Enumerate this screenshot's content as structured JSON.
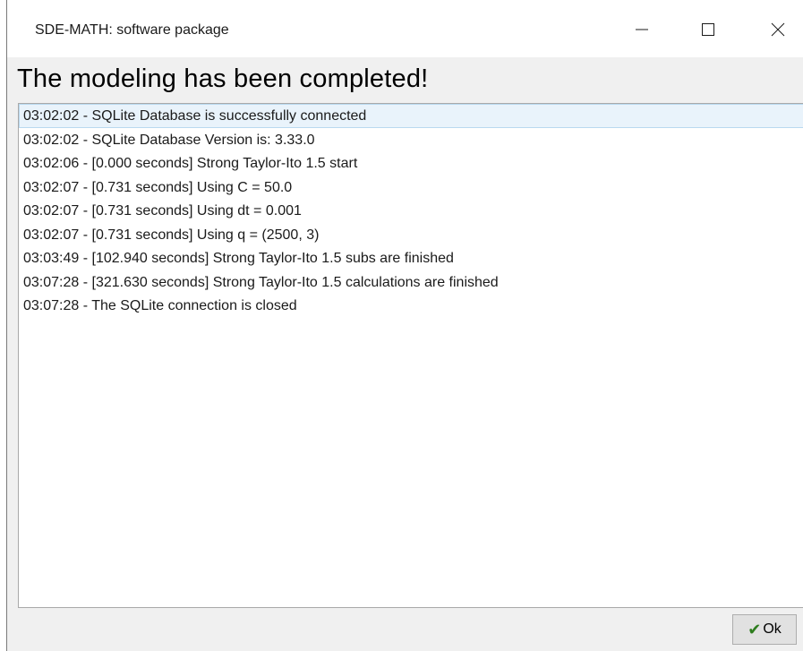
{
  "window": {
    "title": "SDE-MATH: software package",
    "controls": {
      "minimize_icon": "minimize-icon",
      "maximize_icon": "maximize-icon",
      "close_icon": "close-icon"
    }
  },
  "main": {
    "heading": "The modeling has been completed!",
    "log": [
      "03:02:02 - SQLite Database is successfully connected",
      "03:02:02 - SQLite Database Version is: 3.33.0",
      "03:02:06 - [0.000 seconds] Strong Taylor-Ito 1.5 start",
      "03:02:07 - [0.731 seconds] Using C = 50.0",
      "03:02:07 - [0.731 seconds] Using dt = 0.001",
      "03:02:07 - [0.731 seconds] Using q = (2500, 3)",
      "03:03:49 - [102.940 seconds] Strong Taylor-Ito 1.5 subs are finished",
      "03:07:28 - [321.630 seconds] Strong Taylor-Ito 1.5 calculations are finished",
      "03:07:28 - The SQLite connection is closed"
    ],
    "selected_index": 0
  },
  "footer": {
    "ok_label": "Ok",
    "ok_icon": "checkmark-icon"
  },
  "colors": {
    "selection_bg": "#e9f3fb",
    "selection_border": "#b9d9f0",
    "check_green": "#2e7d1e"
  }
}
